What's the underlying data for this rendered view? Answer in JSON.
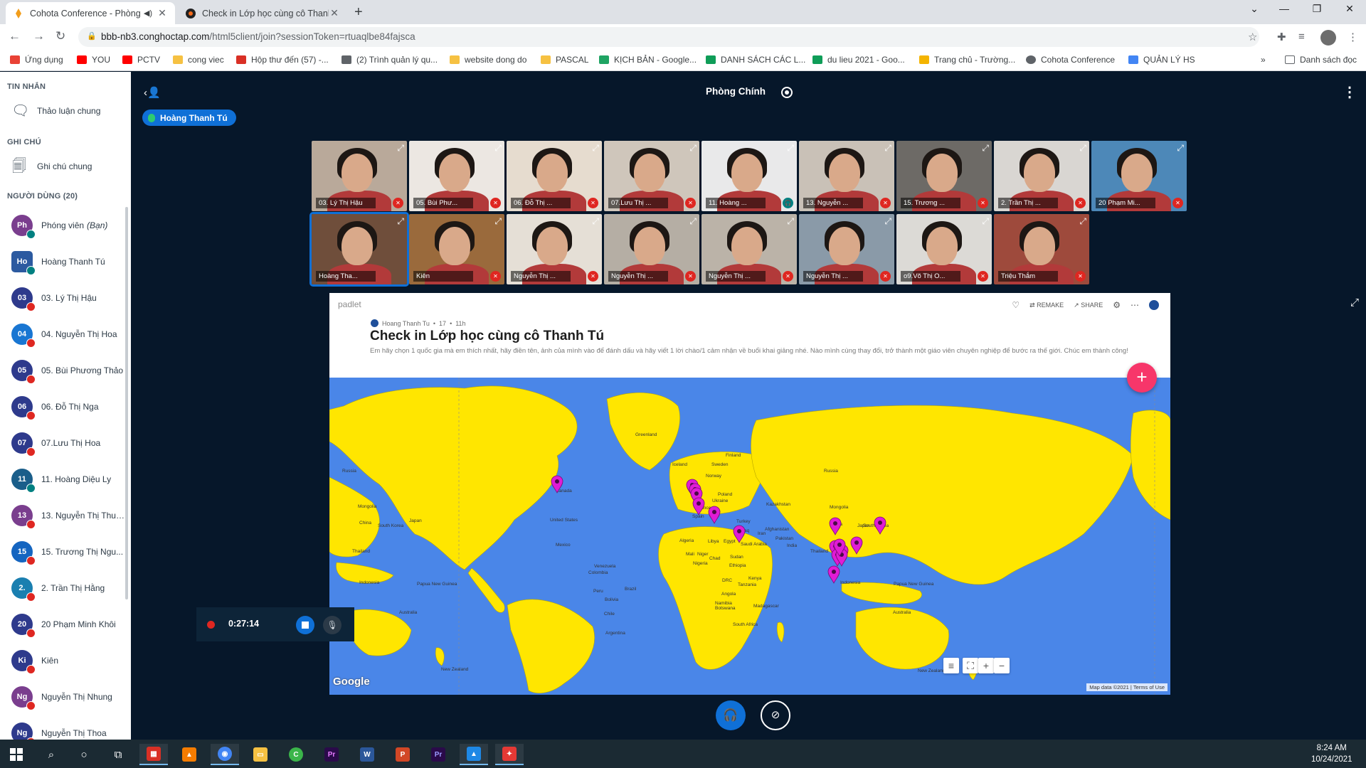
{
  "browser": {
    "tabs": [
      {
        "title": "Cohota Conference - Phòng",
        "active": true,
        "audio": true
      },
      {
        "title": "Check in Lớp học cùng cô Thanh",
        "active": false,
        "audio": false
      }
    ],
    "url_host": "bbb-nb3.conghoctap.com",
    "url_path": "/html5client/join?sessionToken=rtuaqlbe84fajsca",
    "bookmarks": [
      {
        "label": "Ứng dụng",
        "color": "#e94235"
      },
      {
        "label": "YOU",
        "color": "#ff0000"
      },
      {
        "label": "PCTV",
        "color": "#ff0000"
      },
      {
        "label": "cong viec",
        "color": "#f6c142"
      },
      {
        "label": "Hộp thư đến (57) -...",
        "color": "#d93025"
      },
      {
        "label": "(2) Trình quản lý qu...",
        "color": "#5f6368"
      },
      {
        "label": "website dong do",
        "color": "#f6c142"
      },
      {
        "label": "PASCAL",
        "color": "#f6c142"
      },
      {
        "label": "KỊCH BẢN - Google...",
        "color": "#1fa463"
      },
      {
        "label": "DANH SÁCH CÁC L...",
        "color": "#0f9d58"
      },
      {
        "label": "du lieu 2021 - Goo...",
        "color": "#0f9d58"
      },
      {
        "label": "Trang chủ - Trường...",
        "color": "#f4b400"
      },
      {
        "label": "Cohota Conference",
        "color": "#5f6368"
      },
      {
        "label": "QUẢN LÝ HS",
        "color": "#4285f4"
      }
    ],
    "bookmarks_more": "»",
    "reading_list": "Danh sách đọc"
  },
  "sidebar": {
    "messages_title": "TIN NHẮN",
    "public_chat": "Thảo luận chung",
    "notes_title": "GHI CHÚ",
    "shared_notes": "Ghi chú chung",
    "users_title": "NGƯỜI DÙNG (20)",
    "users": [
      {
        "initials": "Ph",
        "name": "Phóng viên",
        "suffix": "(Bạn)",
        "color": "#7a3e8e",
        "status": "listen",
        "square": false
      },
      {
        "initials": "Ho",
        "name": "Hoàng Thanh Tú",
        "suffix": "",
        "color": "#2c5aa0",
        "status": "listen",
        "square": true
      },
      {
        "initials": "03",
        "name": "03. Lý Thị Hậu",
        "suffix": "",
        "color": "#2e3a8c",
        "status": "muted",
        "square": false
      },
      {
        "initials": "04",
        "name": "04. Nguyễn Thị Hoa",
        "suffix": "",
        "color": "#1976d2",
        "status": "muted",
        "square": false
      },
      {
        "initials": "05",
        "name": "05. Bùi Phương Thảo",
        "suffix": "",
        "color": "#2e3a8c",
        "status": "muted",
        "square": false
      },
      {
        "initials": "06",
        "name": "06. Đỗ Thị Nga",
        "suffix": "",
        "color": "#2e3a8c",
        "status": "muted",
        "square": false
      },
      {
        "initials": "07",
        "name": "07.Lưu Thị Hoa",
        "suffix": "",
        "color": "#2e3a8c",
        "status": "muted",
        "square": false
      },
      {
        "initials": "11",
        "name": "11. Hoàng Diệu Ly",
        "suffix": "",
        "color": "#1a5e8a",
        "status": "listen",
        "square": false
      },
      {
        "initials": "13",
        "name": "13. Nguyễn Thị Thu ...",
        "suffix": "",
        "color": "#7a3e8e",
        "status": "muted",
        "square": false
      },
      {
        "initials": "15",
        "name": "15. Trương Thị Ngu...",
        "suffix": "",
        "color": "#1565c0",
        "status": "muted",
        "square": false
      },
      {
        "initials": "2.",
        "name": "2. Trần Thị Hằng",
        "suffix": "",
        "color": "#1a7fb0",
        "status": "muted",
        "square": false
      },
      {
        "initials": "20",
        "name": "20 Phạm Minh Khôi",
        "suffix": "",
        "color": "#2e3a8c",
        "status": "muted",
        "square": false
      },
      {
        "initials": "Ki",
        "name": "Kiên",
        "suffix": "",
        "color": "#2e3a8c",
        "status": "muted",
        "square": false
      },
      {
        "initials": "Ng",
        "name": "Nguyễn Thị Nhung",
        "suffix": "",
        "color": "#7a3e8e",
        "status": "muted",
        "square": false
      },
      {
        "initials": "Ng",
        "name": "Nguyễn Thị Thoa",
        "suffix": "",
        "color": "#2e3a8c",
        "status": "muted",
        "square": false
      }
    ]
  },
  "room": {
    "title": "Phòng Chính",
    "talking_user": "Hoàng Thanh Tú"
  },
  "videos": [
    {
      "label": "03. Lý Thị Hậu",
      "bg": "#b9a99a",
      "mic": "muted"
    },
    {
      "label": "05. Bùi Phư...",
      "bg": "#ece7e2",
      "mic": "muted"
    },
    {
      "label": "06. Đỗ Thị ...",
      "bg": "#e6dccf",
      "mic": "muted"
    },
    {
      "label": "07.Lưu Thị ...",
      "bg": "#cfc6bb",
      "mic": "muted"
    },
    {
      "label": "11. Hoàng ...",
      "bg": "#e9e9ea",
      "mic": "on"
    },
    {
      "label": "13. Nguyễn ...",
      "bg": "#c9c1b7",
      "mic": "muted"
    },
    {
      "label": "15. Trương ...",
      "bg": "#6d6a66",
      "mic": "muted"
    },
    {
      "label": "2. Trần Thị ...",
      "bg": "#d9d6d2",
      "mic": "muted"
    },
    {
      "label": "20 Phạm Mi...",
      "bg": "#4d88b8",
      "mic": "muted"
    },
    {
      "label": "Hoàng Tha...",
      "bg": "#6f4e3b",
      "mic": "none"
    },
    {
      "label": "Kiên",
      "bg": "#9a6a3c",
      "mic": "muted"
    },
    {
      "label": "Nguyễn Thị ...",
      "bg": "#e5dfd6",
      "mic": "muted"
    },
    {
      "label": "Nguyễn Thị ...",
      "bg": "#b5aea4",
      "mic": "muted"
    },
    {
      "label": "Nguyễn Thị ...",
      "bg": "#bbb3a8",
      "mic": "muted"
    },
    {
      "label": "Nguyễn Thị ...",
      "bg": "#8a9aa8",
      "mic": "muted"
    },
    {
      "label": "o9.Võ Thị O...",
      "bg": "#dcdad6",
      "mic": "muted"
    },
    {
      "label": "Triệu Thắm",
      "bg": "#9e4a3c",
      "mic": "muted"
    }
  ],
  "padlet": {
    "brand": "padlet",
    "author": "Hoang Thanh Tu",
    "likes": "17",
    "age": "11h",
    "title": "Check in Lớp học cùng cô Thanh Tú",
    "description": "Em hãy chọn 1 quốc gia mà em thích nhất, hãy điền tên, ảnh của mình vào để đánh dấu và hãy viết 1 lời chào/1 cảm nhận về buổi khai giảng nhé. Nào mình cùng thay đổi, trở thành một giáo viên chuyên nghiệp để bước ra thế giới. Chúc em thành công!",
    "remake": "REMAKE",
    "share": "SHARE",
    "map_labels": [
      "Greenland",
      "Iceland",
      "Sweden",
      "Finland",
      "Norway",
      "Russia",
      "Russia",
      "Canada",
      "United States",
      "Mexico",
      "Venezuela",
      "Colombia",
      "Peru",
      "Brazil",
      "Bolivia",
      "Chile",
      "Argentina",
      "France",
      "Spain",
      "Poland",
      "Ukraine",
      "Turkey",
      "Kazakhstan",
      "Mongolia",
      "China",
      "Japan",
      "South Korea",
      "Afghanistan",
      "Pakistan",
      "India",
      "Iraq",
      "Iran",
      "Saudi Arabia",
      "Egypt",
      "Libya",
      "Algeria",
      "Mali",
      "Niger",
      "Chad",
      "Sudan",
      "Nigeria",
      "Ethiopia",
      "DRC",
      "Kenya",
      "Tanzania",
      "Angola",
      "Namibia",
      "Botswana",
      "Madagascar",
      "South Africa",
      "Thailand",
      "Indonesia",
      "Papua New Guinea",
      "Australia",
      "Mongolia",
      "China",
      "South Korea",
      "Japan",
      "Thailand",
      "Indonesia",
      "Papua New Guinea",
      "Australia",
      "New Zealand",
      "New Zealand"
    ],
    "pin_count": 17,
    "map_attrib": "Map data ©2021",
    "terms": "Terms of Use",
    "google": "Google"
  },
  "recording": {
    "time": "0:27:14"
  },
  "taskbar": {
    "time": "8:24 AM",
    "date": "10/24/2021"
  },
  "colors": {
    "bbb_bg": "#06172a",
    "bbb_primary": "#0f70d7",
    "muted_red": "#df2721",
    "map_water": "#4a86e8",
    "map_land": "#ffe600",
    "pin": "#e01cd5",
    "padlet_plus": "#f7366a"
  }
}
